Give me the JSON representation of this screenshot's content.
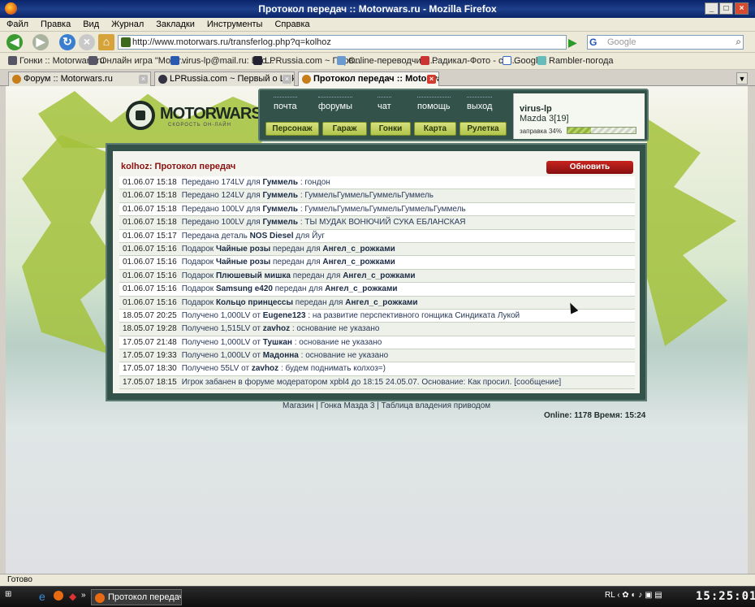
{
  "window": {
    "title": "Протокол передач :: Motorwars.ru - Mozilla Firefox"
  },
  "menu": [
    "Файл",
    "Правка",
    "Вид",
    "Журнал",
    "Закладки",
    "Инструменты",
    "Справка"
  ],
  "nav": {
    "url": "http://www.motorwars.ru/transferlog.php?q=kolhoz",
    "search_placeholder": "Google",
    "search_engine": "G"
  },
  "bookmarks": [
    "Гонки :: Motorwars.ru",
    "Онлайн игра \"Motor...",
    "virus-lp@mail.ru: Вхо...",
    "LPRussia.com ~ Перв...",
    "Online-переводчик :...",
    "Радикал-Фото - соз...",
    "Google",
    "Rambler-погода"
  ],
  "tabs": [
    {
      "label": "Форум :: Motorwars.ru",
      "active": false
    },
    {
      "label": "LPRussia.com ~ Первый о Linkin Park ...",
      "active": false
    },
    {
      "label": "Протокол передач :: Motorwars....",
      "active": true
    }
  ],
  "site": {
    "logo": "MOTORWARS.RU",
    "logo_sub": "СКОРОСТЬ ОН-ЛАЙН",
    "top_links": [
      "почта",
      "форумы",
      "чат",
      "помощь",
      "выход"
    ],
    "buttons": [
      "Персонаж",
      "Гараж",
      "Гонки",
      "Карта",
      "Рулетка"
    ],
    "user": {
      "name": "virus-lp",
      "car": "Mazda 3[19]",
      "fuel_label": "заправка 34%",
      "fuel_level": 0.34
    }
  },
  "log": {
    "title": "kolhoz: Протокол передач",
    "refresh": "Обновить",
    "rows": [
      {
        "date": "01.06.07 15:18",
        "pre": "Передано 174LV для ",
        "bold1": "Гуммель",
        "mid": " : гондон",
        "bold2": "",
        "post": ""
      },
      {
        "date": "01.06.07 15:18",
        "pre": "Передано 124LV для ",
        "bold1": "Гуммель",
        "mid": " : ГуммельГуммельГуммельГуммель",
        "bold2": "",
        "post": ""
      },
      {
        "date": "01.06.07 15:18",
        "pre": "Передано 100LV для ",
        "bold1": "Гуммель",
        "mid": " : ГуммельГуммельГуммельГуммельГуммель",
        "bold2": "",
        "post": ""
      },
      {
        "date": "01.06.07 15:18",
        "pre": "Передано 100LV для ",
        "bold1": "Гуммель",
        "mid": " : ТЫ МУДАК ВОНЮЧИЙ СУКА ЕБЛАНСКАЯ",
        "bold2": "",
        "post": ""
      },
      {
        "date": "01.06.07 15:17",
        "pre": "Передана деталь ",
        "bold1": "NOS Diesel",
        "mid": " для Йуг",
        "bold2": "",
        "post": ""
      },
      {
        "date": "01.06.07 15:16",
        "pre": "Подарок ",
        "bold1": "Чайные розы",
        "mid": " передан для ",
        "bold2": "Ангел_с_рожками",
        "post": ""
      },
      {
        "date": "01.06.07 15:16",
        "pre": "Подарок ",
        "bold1": "Чайные розы",
        "mid": " передан для ",
        "bold2": "Ангел_с_рожками",
        "post": ""
      },
      {
        "date": "01.06.07 15:16",
        "pre": "Подарок ",
        "bold1": "Плюшевый мишка",
        "mid": " передан для ",
        "bold2": "Ангел_с_рожками",
        "post": ""
      },
      {
        "date": "01.06.07 15:16",
        "pre": "Подарок ",
        "bold1": "Samsung e420",
        "mid": " передан для ",
        "bold2": "Ангел_с_рожками",
        "post": ""
      },
      {
        "date": "01.06.07 15:16",
        "pre": "Подарок ",
        "bold1": "Кольцо принцессы",
        "mid": " передан для ",
        "bold2": "Ангел_с_рожками",
        "post": ""
      },
      {
        "date": "18.05.07 20:25",
        "pre": "Получено 1,000LV от ",
        "bold1": "Eugene123",
        "mid": " : на развитие перспективного гонщика Синдиката Лукой",
        "bold2": "",
        "post": ""
      },
      {
        "date": "18.05.07 19:28",
        "pre": "Получено 1,515LV от ",
        "bold1": "zavhoz",
        "mid": " : основание не указано",
        "bold2": "",
        "post": ""
      },
      {
        "date": "17.05.07 21:48",
        "pre": "Получено 1,000LV от ",
        "bold1": "Тушкан",
        "mid": " : основание не указано",
        "bold2": "",
        "post": ""
      },
      {
        "date": "17.05.07 19:33",
        "pre": "Получено 1,000LV от ",
        "bold1": "Мадонна",
        "mid": " : основание не указано",
        "bold2": "",
        "post": ""
      },
      {
        "date": "17.05.07 18:30",
        "pre": "Получено 55LV от ",
        "bold1": "zavhoz",
        "mid": " : будем поднимать колхоз=)",
        "bold2": "",
        "post": ""
      },
      {
        "date": "17.05.07 18:15",
        "pre": "Игрок забанен в форуме модератором xpbl4 до 18:15 24.05.07. Основание: Как просил. [сообщение]",
        "bold1": "",
        "mid": "",
        "bold2": "",
        "post": ""
      }
    ]
  },
  "footer": {
    "links": "Магазин | Гонка Мазда 3 | Таблица владения приводом",
    "stats": "Online: 1178  Время: 15:24"
  },
  "status": "Готово",
  "taskbar": {
    "item": "Протокол передач :...",
    "lang": "RL",
    "clock": "15:25:01"
  }
}
